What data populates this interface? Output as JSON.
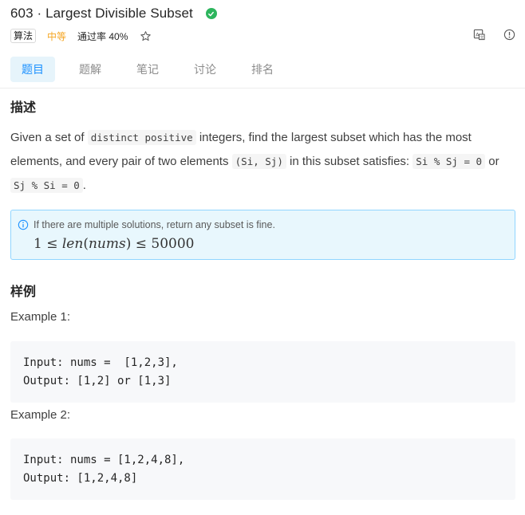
{
  "header": {
    "title": "603 · Largest Divisible Subset",
    "tag": "算法",
    "difficulty": "中等",
    "ac_rate": "通过率 40%",
    "colors": {
      "difficulty": "#f5a623",
      "check": "#2db55d",
      "active_tab": "#1a90ff"
    }
  },
  "tabs": [
    {
      "label": "题目",
      "active": true
    },
    {
      "label": "题解",
      "active": false
    },
    {
      "label": "笔记",
      "active": false
    },
    {
      "label": "讨论",
      "active": false
    },
    {
      "label": "排名",
      "active": false
    }
  ],
  "description": {
    "heading": "描述",
    "t1": "Given a set of ",
    "c1": "distinct positive",
    "t2": " integers, find the largest subset which has the most elements, and every pair of two elements ",
    "c2": "(Si, Sj)",
    "t3": " in this subset satisfies: ",
    "c3": "Si % Sj = 0",
    "t4": " or ",
    "c4": "Sj % Si = 0",
    "t5": "."
  },
  "note": {
    "text": "If there are multiple solutions, return any subset is fine.",
    "constraint_pre": "1 ≤ ",
    "constraint_len": "len",
    "constraint_open": "(",
    "constraint_nums": "nums",
    "constraint_post": ") ≤ 50000"
  },
  "examples": {
    "heading": "样例",
    "items": [
      {
        "label": "Example 1:",
        "code": "Input: nums =  [1,2,3],\nOutput: [1,2] or [1,3]"
      },
      {
        "label": "Example 2:",
        "code": "Input: nums = [1,2,4,8],\nOutput: [1,2,4,8]"
      }
    ]
  }
}
